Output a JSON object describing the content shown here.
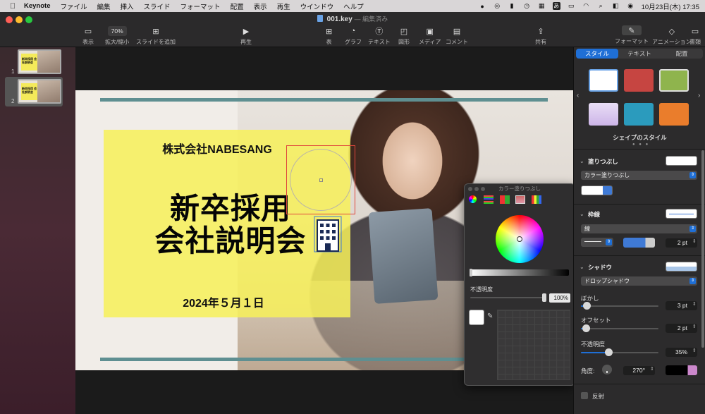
{
  "menubar": {
    "app": "Keynote",
    "items": [
      "ファイル",
      "編集",
      "挿入",
      "スライド",
      "フォーマット",
      "配置",
      "表示",
      "再生",
      "ウインドウ",
      "ヘルプ"
    ],
    "clock": "10月23日(木) 17:35",
    "input_mode": "あ"
  },
  "window": {
    "doc_title": "001.key",
    "doc_status": "— 編集済み"
  },
  "toolbar": {
    "view": "表示",
    "zoom_value": "70%",
    "zoom_label": "拡大/縮小",
    "add_slide": "スライドを追加",
    "play": "再生",
    "table": "表",
    "chart": "グラフ",
    "text": "テキスト",
    "shape": "図形",
    "media": "メディア",
    "comment": "コメント",
    "share": "共有",
    "format": "フォーマット",
    "animate": "アニメーション",
    "document": "書類"
  },
  "slides": [
    {
      "num": "1",
      "thumb_text": "新卒採用 会社説明会"
    },
    {
      "num": "2",
      "thumb_text": "新卒採用 会社説明会"
    }
  ],
  "slide": {
    "company": "株式会社NABESANG",
    "heading_line1": "新卒採用",
    "heading_line2": "会社説明会",
    "date": "2024年５月１日"
  },
  "inspector": {
    "tabs": [
      "スタイル",
      "テキスト",
      "配置"
    ],
    "active_tab": "スタイル",
    "shape_styles_label": "シェイプのスタイル",
    "swatches": [
      "#ffffff",
      "#c64541",
      "#8fb44d",
      "#d9c8ee",
      "#2b9bbd",
      "#ea7d2c"
    ],
    "fill": {
      "label": "塗りつぶし",
      "type": "カラー塗りつぶし",
      "color": "#ffffff"
    },
    "stroke": {
      "label": "枠線",
      "type": "線",
      "color": "#3f7ad6",
      "width": "2 pt"
    },
    "shadow": {
      "label": "シャドウ",
      "type": "ドロップシャドウ",
      "blur_label": "ぼかし",
      "blur": "3 pt",
      "offset_label": "オフセット",
      "offset": "2 pt",
      "opacity_label": "不透明度",
      "opacity": "35%",
      "opacity_level": 0.35,
      "angle_label": "角度:",
      "angle": "270°"
    },
    "reflection": "反射"
  },
  "color_window": {
    "title": "カラー塗りつぶし",
    "opacity_label": "不透明度",
    "opacity": "100%"
  }
}
